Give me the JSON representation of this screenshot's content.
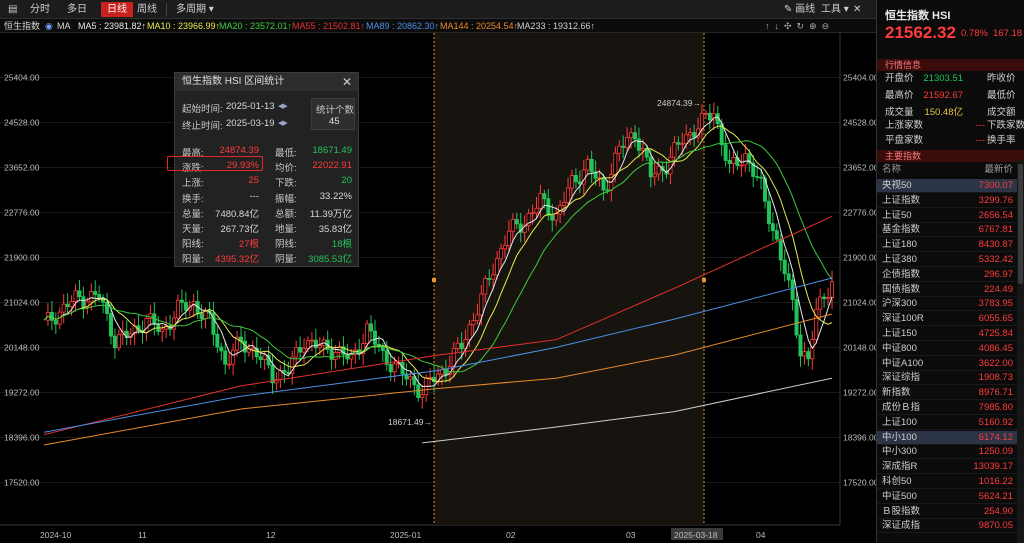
{
  "toolbar": {
    "items": [
      {
        "label": "分时",
        "active": false
      },
      {
        "label": "多日",
        "active": false
      },
      {
        "label": "日线",
        "active": true
      },
      {
        "label": "周线",
        "active": false
      },
      {
        "label": "多周期 ▾",
        "active": false
      }
    ],
    "draw_label": "画线",
    "tools_label": "工具 ▾"
  },
  "ma_bar": {
    "index_label": "恒生指数",
    "ma_label": "MA",
    "items": [
      {
        "text": "MA5 : 23981.82↑",
        "color": "#e8e8e8"
      },
      {
        "text": "MA10 : 23966.99↑",
        "color": "#e8e850"
      },
      {
        "text": "MA20 : 23572.01↑",
        "color": "#3ccb3c"
      },
      {
        "text": "MA55 : 21502.81↑",
        "color": "#e83030"
      },
      {
        "text": "MA89 : 20862.30↑",
        "color": "#4b8fe8"
      },
      {
        "text": "MA144 : 20254.54↑",
        "color": "#e88a2c"
      },
      {
        "text": "MA233 : 19312.66↑",
        "color": "#cfcfcf"
      }
    ]
  },
  "chart_data": {
    "type": "candlestick",
    "y_ticks": [
      25404.0,
      24528.0,
      23652.0,
      22776.0,
      21900.0,
      21024.0,
      20148.0,
      19272.0,
      18396.0,
      17520.0
    ],
    "x_labels": [
      "2024-10",
      "11",
      "12",
      "2025-01",
      "02",
      "03",
      "2025-03-18",
      "04"
    ],
    "annotations": {
      "high": "24874.39",
      "low": "18671.49"
    },
    "colors": {
      "up": "#ff3b3b",
      "down": "#22c35a"
    }
  },
  "popup": {
    "title": "恒生指数  HSI 区间统计",
    "start_label": "起始时间:",
    "start_date": "2025-01-13",
    "end_label": "终止时间:",
    "end_date": "2025-03-19",
    "count_label": "统计个数",
    "count_value": "45",
    "rows": [
      {
        "l1": "最高:",
        "v1": "24874.39",
        "c1": "red",
        "l2": "最低:",
        "v2": "18671.49",
        "c2": "green"
      },
      {
        "l1": "涨跌:",
        "v1": "29.93%",
        "c1": "red",
        "l2": "均价:",
        "v2": "22022.91",
        "c2": "red"
      },
      {
        "l1": "上涨:",
        "v1": "25",
        "c1": "red",
        "l2": "下跌:",
        "v2": "20",
        "c2": "green"
      },
      {
        "l1": "换手:",
        "v1": "---",
        "c1": "white",
        "l2": "振幅:",
        "v2": "33.22%",
        "c2": "white"
      },
      {
        "l1": "总量:",
        "v1": "7480.84亿",
        "c1": "white",
        "l2": "总额:",
        "v2": "11.39万亿",
        "c2": "white"
      },
      {
        "l1": "天量:",
        "v1": "267.73亿",
        "c1": "white",
        "l2": "地量:",
        "v2": "35.83亿",
        "c2": "white"
      },
      {
        "l1": "阳线:",
        "v1": "27根",
        "c1": "red",
        "l2": "阴线:",
        "v2": "18根",
        "c2": "green"
      },
      {
        "l1": "阳量:",
        "v1": "4395.32亿",
        "c1": "red",
        "l2": "阴量:",
        "v2": "3085.53亿",
        "c2": "green"
      }
    ]
  },
  "panel": {
    "title": "恒生指数 HSI",
    "price": "21562.32",
    "pct": "0.78%",
    "change": "167.18",
    "quote_header": "行情信息",
    "quote_rows": [
      {
        "k1": "开盘价",
        "v1": "21303.51",
        "c1": "#22c35a",
        "k2": "昨收价"
      },
      {
        "k1": "最高价",
        "v1": "21592.67",
        "c1": "#ff3b3b",
        "k2": "最低价"
      },
      {
        "k1": "成交量",
        "v1": "150.48亿",
        "c1": "#e8c040",
        "k2": "成交额"
      }
    ],
    "breadth_rows": [
      {
        "k1": "上涨家数",
        "v1": "---",
        "k2": "下跌家数"
      },
      {
        "k1": "平盘家数",
        "v1": "---",
        "k2": "换手率"
      }
    ],
    "index_header": "主要指数",
    "col_name": "名称",
    "col_price": "最新价",
    "indices": [
      {
        "name": "央视50",
        "price": "7300.07",
        "sel": true
      },
      {
        "name": "上证指数",
        "price": "3299.76",
        "sel": false
      },
      {
        "name": "上证50",
        "price": "2656.54",
        "sel": false
      },
      {
        "name": "基金指数",
        "price": "6767.81",
        "sel": false
      },
      {
        "name": "上证180",
        "price": "8430.87",
        "sel": false
      },
      {
        "name": "上证380",
        "price": "5332.42",
        "sel": false
      },
      {
        "name": "企债指数",
        "price": "296.97",
        "sel": false
      },
      {
        "name": "国债指数",
        "price": "224.49",
        "sel": false
      },
      {
        "name": "沪深300",
        "price": "3783.95",
        "sel": false
      },
      {
        "name": "深证100R",
        "price": "6055.65",
        "sel": false
      },
      {
        "name": "上证150",
        "price": "4725.84",
        "sel": false
      },
      {
        "name": "中证800",
        "price": "4086.45",
        "sel": false
      },
      {
        "name": "中证A100",
        "price": "3622.00",
        "sel": false
      },
      {
        "name": "深证综指",
        "price": "1908.73",
        "sel": false
      },
      {
        "name": "新指数",
        "price": "8976.71",
        "sel": false
      },
      {
        "name": "成份Ｂ指",
        "price": "7985.80",
        "sel": false
      },
      {
        "name": "上证100",
        "price": "5160.92",
        "sel": false
      },
      {
        "name": "中小100",
        "price": "6174.12",
        "sel": true
      },
      {
        "name": "中小300",
        "price": "1250.09",
        "sel": false
      },
      {
        "name": "深成指R",
        "price": "13039.17",
        "sel": false
      },
      {
        "name": "科创50",
        "price": "1016.22",
        "sel": false
      },
      {
        "name": "中证500",
        "price": "5624.21",
        "sel": false
      },
      {
        "name": "Ｂ股指数",
        "price": "254.90",
        "sel": false
      },
      {
        "name": "深证成指",
        "price": "9870.05",
        "sel": false
      }
    ]
  }
}
